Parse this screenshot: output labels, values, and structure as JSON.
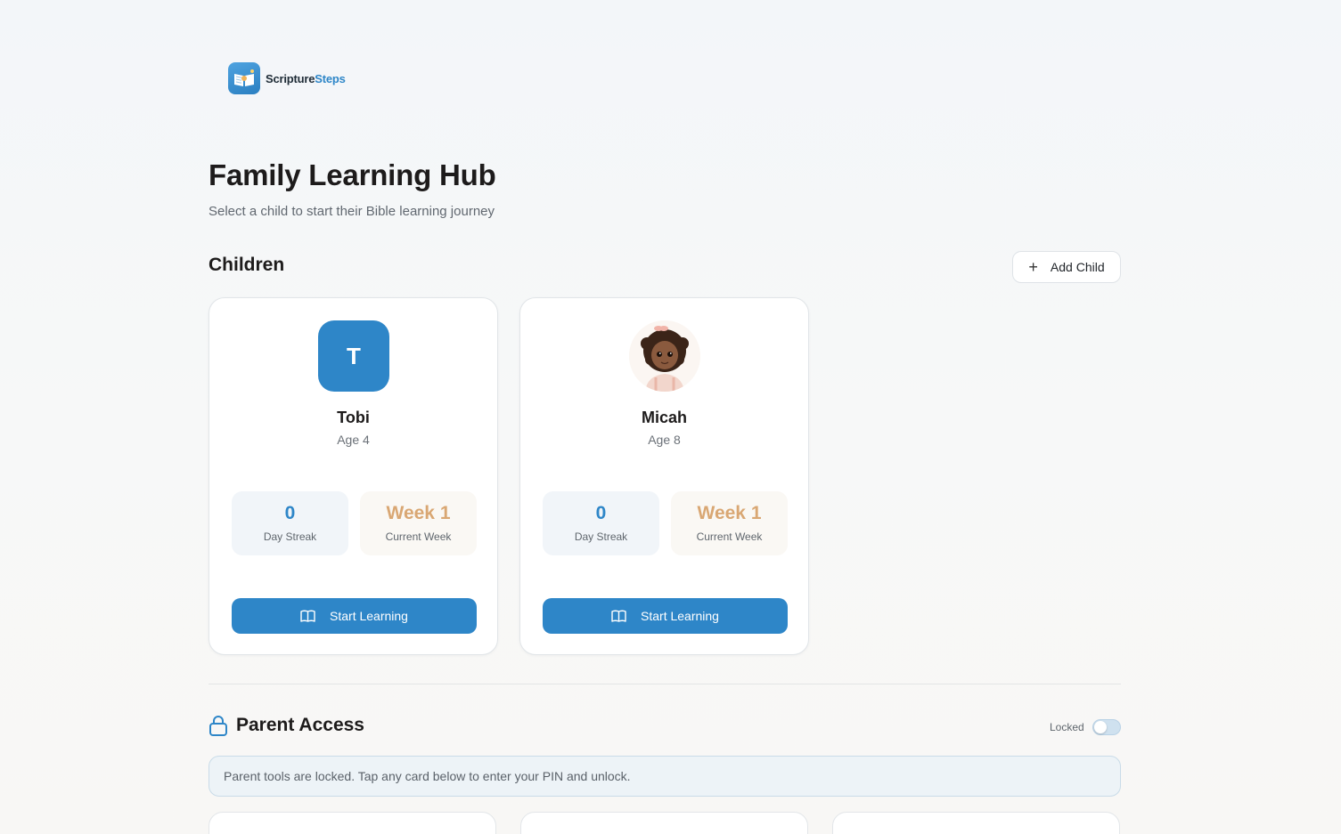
{
  "brand": {
    "name_part1": "Scripture",
    "name_part2": "Steps",
    "logo_icon": "open-book-icon",
    "accent": "#2e86c8"
  },
  "header": {
    "title": "Family Learning Hub",
    "subtitle": "Select a child to start their Bible learning journey"
  },
  "children_section": {
    "title": "Children",
    "add_child_label": "Add Child",
    "children": [
      {
        "name": "Tobi",
        "age": "Age 4",
        "avatar_initial": "T",
        "avatar_type": "initial",
        "streak_value": "0",
        "streak_label": "Day Streak",
        "week_value": "Week 1",
        "week_label": "Current Week",
        "action_label": "Start Learning"
      },
      {
        "name": "Micah",
        "age": "Age 8",
        "avatar_type": "photo",
        "streak_value": "0",
        "streak_label": "Day Streak",
        "week_value": "Week 1",
        "week_label": "Current Week",
        "action_label": "Start Learning"
      }
    ]
  },
  "parent_access": {
    "title": "Parent Access",
    "lock_state_label": "Locked",
    "locked": true,
    "notice": "Parent tools are locked. Tap any card below to enter your PIN and unlock."
  },
  "colors": {
    "primary": "#2e86c8",
    "week_accent": "#d9a773"
  }
}
